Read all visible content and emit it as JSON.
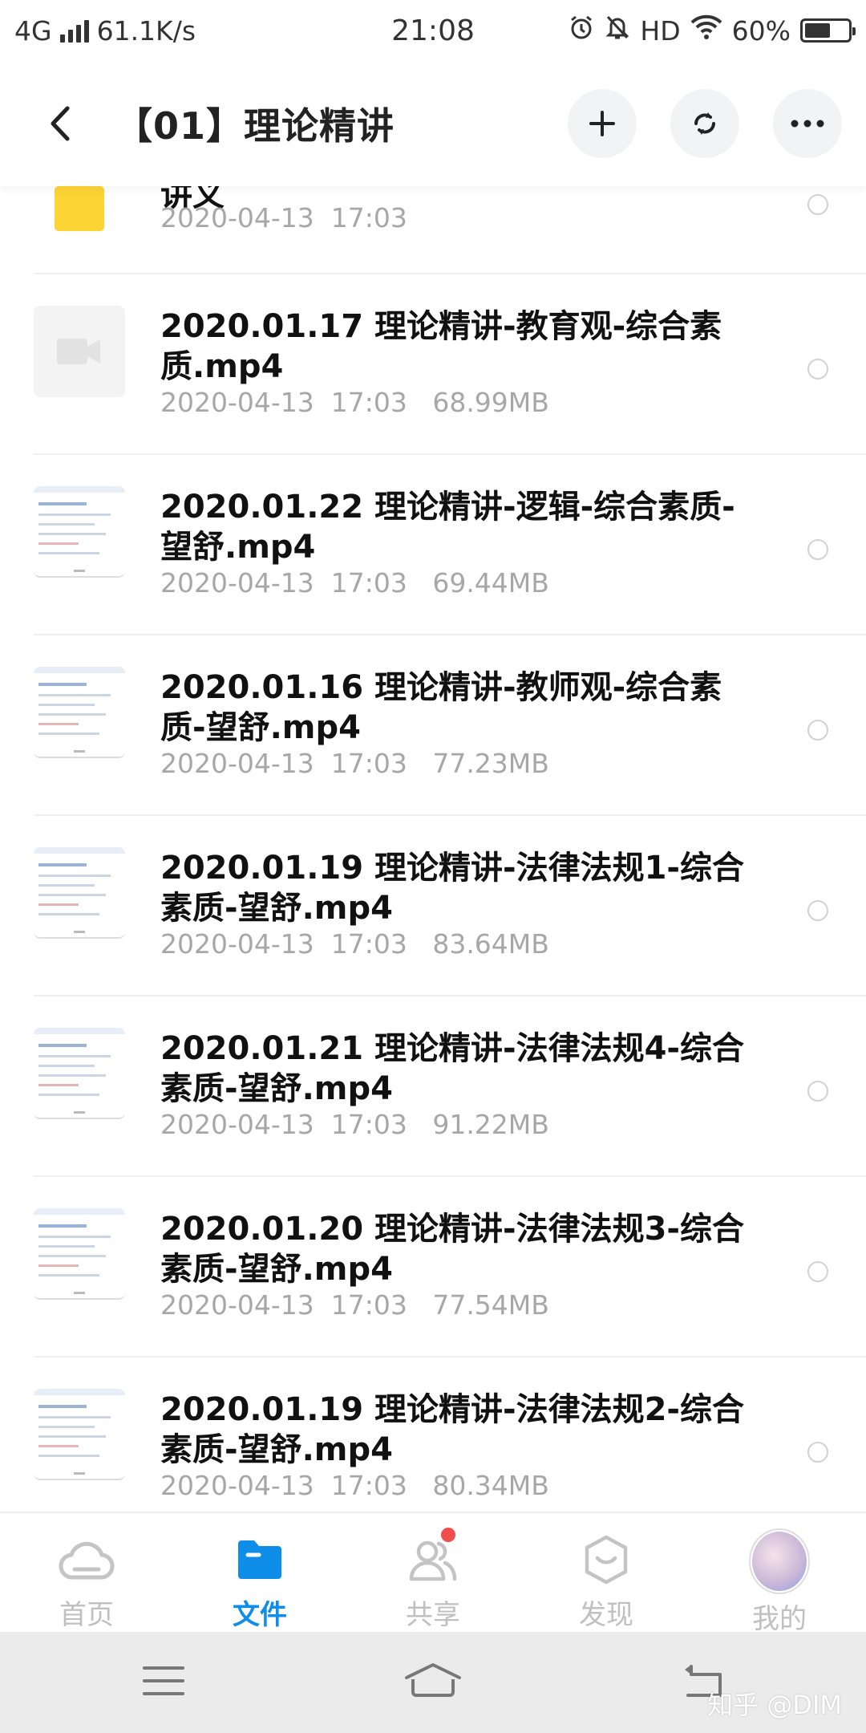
{
  "status_bar": {
    "network": "4G",
    "speed": "61.1K/s",
    "time": "21:08",
    "hd": "HD",
    "battery": "60%",
    "battery_level": 0.6
  },
  "header": {
    "title": "【01】理论精讲"
  },
  "folder": {
    "name": "讲义",
    "meta": "2020-04-13  17:03"
  },
  "files": [
    {
      "name": "2020.01.17 理论精讲-教育观-综合素质.mp4",
      "meta": "2020-04-13  17:03   68.99MB",
      "thumb": "video"
    },
    {
      "name": "2020.01.22 理论精讲-逻辑-综合素质-望舒.mp4",
      "meta": "2020-04-13  17:03   69.44MB",
      "thumb": "slide"
    },
    {
      "name": "2020.01.16 理论精讲-教师观-综合素质-望舒.mp4",
      "meta": "2020-04-13  17:03   77.23MB",
      "thumb": "slide"
    },
    {
      "name": "2020.01.19 理论精讲-法律法规1-综合素质-望舒.mp4",
      "meta": "2020-04-13  17:03   83.64MB",
      "thumb": "slide"
    },
    {
      "name": "2020.01.21 理论精讲-法律法规4-综合素质-望舒.mp4",
      "meta": "2020-04-13  17:03   91.22MB",
      "thumb": "slide"
    },
    {
      "name": "2020.01.20 理论精讲-法律法规3-综合素质-望舒.mp4",
      "meta": "2020-04-13  17:03   77.54MB",
      "thumb": "slide"
    },
    {
      "name": "2020.01.19 理论精讲-法律法规2-综合素质-望舒.mp4",
      "meta": "2020-04-13  17:03   80.34MB",
      "thumb": "slide"
    }
  ],
  "tabs": [
    {
      "label": "首页",
      "icon": "cloud-icon"
    },
    {
      "label": "文件",
      "icon": "folder-icon"
    },
    {
      "label": "共享",
      "icon": "people-icon"
    },
    {
      "label": "发现",
      "icon": "discover-icon"
    },
    {
      "label": "我的",
      "icon": "avatar"
    }
  ],
  "watermark": "知乎 @DIM",
  "colors": {
    "accent": "#0e8ee9",
    "folder": "#fcd434",
    "badge": "#f24d4d",
    "meta_text": "#a7a7a7"
  }
}
